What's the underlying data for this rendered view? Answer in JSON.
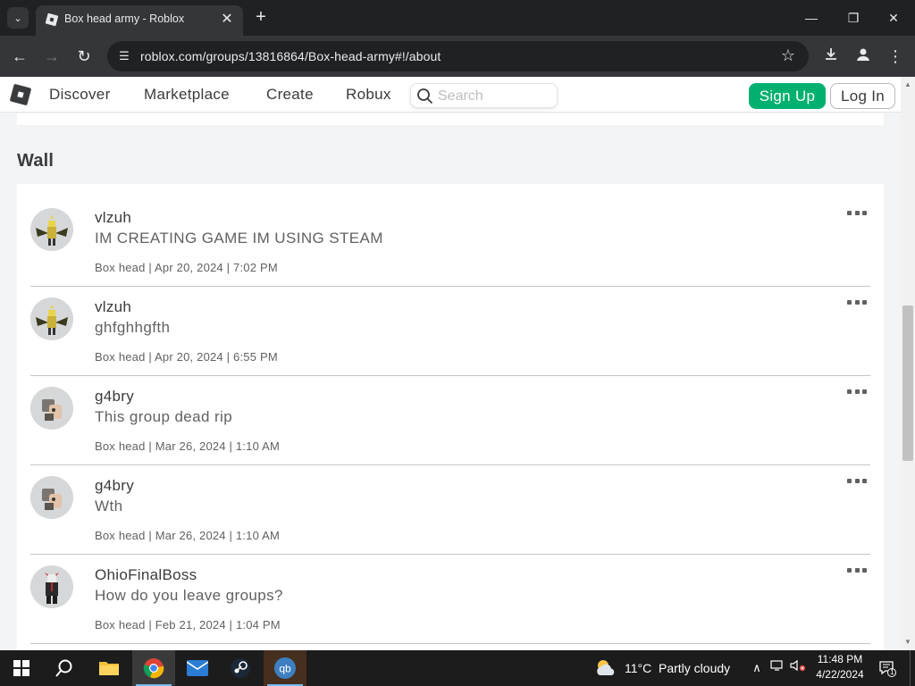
{
  "browser": {
    "tab_title": "Box head army - Roblox",
    "url": "roblox.com/groups/13816864/Box-head-army#!/about"
  },
  "nav": {
    "links": [
      "Discover",
      "Marketplace",
      "Create",
      "Robux"
    ],
    "search_placeholder": "Search",
    "signup_label": "Sign Up",
    "login_label": "Log In"
  },
  "wall": {
    "title": "Wall",
    "posts": [
      {
        "user": "vlzuh",
        "body": "IM CREATING GAME IM USING STEAM",
        "meta": "Box head | Apr 20, 2024 | 7:02 PM",
        "avatar": "yellow-wings-avatar"
      },
      {
        "user": "vlzuh",
        "body": "ghfghhgfth",
        "meta": "Box head | Apr 20, 2024 | 6:55 PM",
        "avatar": "yellow-wings-avatar"
      },
      {
        "user": "g4bry",
        "body": "This group dead rip",
        "meta": "Box head | Mar 26, 2024 | 1:10 AM",
        "avatar": "grey-robot-avatar"
      },
      {
        "user": "g4bry",
        "body": "Wth",
        "meta": "Box head | Mar 26, 2024 | 1:10 AM",
        "avatar": "grey-robot-avatar"
      },
      {
        "user": "OhioFinalBoss",
        "body": "How do you leave groups?",
        "meta": "Box head | Feb 21, 2024 | 1:04 PM",
        "avatar": "dark-suit-avatar"
      }
    ]
  },
  "taskbar": {
    "weather_temp": "11°C",
    "weather_condition": "Partly cloudy",
    "time": "11:48 PM",
    "date": "4/22/2024",
    "notification_count": "1"
  },
  "colors": {
    "accent_green": "#00b06f",
    "page_bg": "#f2f4f5",
    "text_primary": "#393b3d",
    "text_secondary": "#606162"
  }
}
